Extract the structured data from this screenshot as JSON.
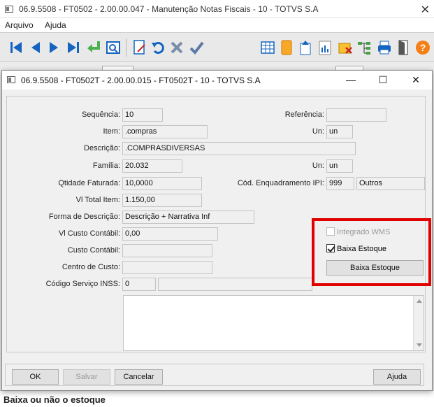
{
  "outer_window": {
    "title": "06.9.5508 - FT0502 - 2.00.00.047 - Manutenção Notas Fiscais - 10 - TOTVS S.A",
    "close": "✕",
    "menu": [
      {
        "label": "Arquivo"
      },
      {
        "label": "Ajuda"
      }
    ],
    "status_text": "Baixa ou não o estoque"
  },
  "toolbar": {
    "icons": [
      "first-icon",
      "previous-icon",
      "next-icon",
      "last-icon",
      "goto-icon",
      "zoom-icon",
      "edit-icon",
      "undo-icon",
      "cancel-icon",
      "confirm-icon",
      "grid-icon",
      "book-icon",
      "import-icon",
      "report-icon",
      "spreadsheet-icon",
      "flow-icon",
      "print-icon",
      "exit-icon",
      "help-icon"
    ]
  },
  "dialog": {
    "title": "06.9.5508 - FT0502T - 2.00.00.015 - FT0502T - 10 - TOTVS S.A",
    "minimize": "—",
    "maximize": "☐",
    "close": "✕",
    "fields": {
      "sequencia": {
        "label": "Sequência:",
        "value": "10"
      },
      "referencia": {
        "label": "Referência:",
        "value": ""
      },
      "item": {
        "label": "Item:",
        "value": ".compras"
      },
      "un1": {
        "label": "Un:",
        "value": "un"
      },
      "descricao": {
        "label": "Descrição:",
        "value": ".COMPRASDIVERSAS"
      },
      "familia": {
        "label": "Família:",
        "value": "20.032"
      },
      "un2": {
        "label": "Un:",
        "value": "un"
      },
      "qtd_faturada": {
        "label": "Qtidade Faturada:",
        "value": "10,0000"
      },
      "cod_enquadramento": {
        "label": "Cód. Enquadramento IPI:",
        "value": "999",
        "desc": "Outros"
      },
      "vl_total_item": {
        "label": "Vl Total Item:",
        "value": "1.150,00"
      },
      "forma_descricao": {
        "label": "Forma de Descrição:",
        "value": "Descrição + Narrativa Inf"
      },
      "vl_custo_contabil": {
        "label": "Vl Custo Contábil:",
        "value": "0,00"
      },
      "custo_contabil": {
        "label": "Custo Contábil:",
        "value": ""
      },
      "centro_custo": {
        "label": "Centro de Custo:",
        "value": ""
      },
      "codigo_servico_inss": {
        "label": "Código Serviço INSS:",
        "value": "0",
        "desc": ""
      }
    },
    "integrado_wms": {
      "label": "Integrado WMS",
      "checked": false
    },
    "baixa_estoque": {
      "label": "Baixa Estoque",
      "checked": true
    },
    "baixa_estoque_button": "Baixa Estoque",
    "buttons": {
      "ok": "OK",
      "salvar": "Salvar",
      "cancelar": "Cancelar",
      "ajuda": "Ajuda"
    }
  },
  "colors": {
    "highlight_border": "#e00000",
    "toolbar_blue": "#1565c0"
  }
}
